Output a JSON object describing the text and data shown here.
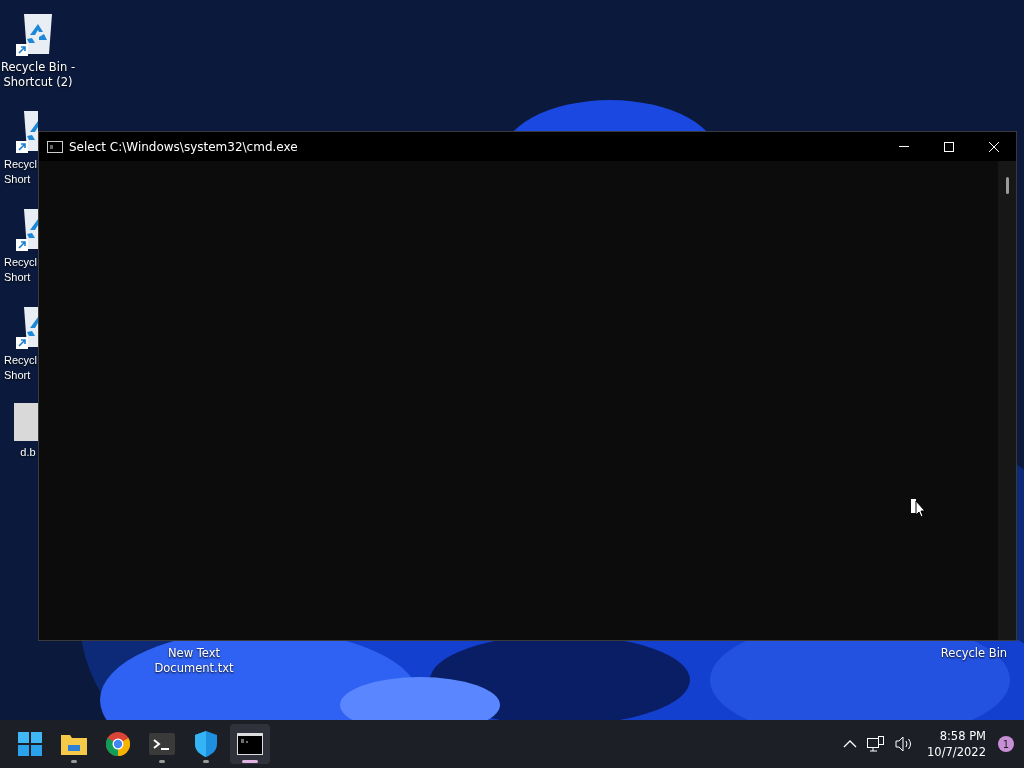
{
  "desktop": {
    "icons": [
      {
        "kind": "recycle",
        "lines": [
          "Recycle Bin -",
          "Shortcut (2)"
        ]
      },
      {
        "kind": "recycle",
        "lines": [
          "Recycl",
          "Short"
        ]
      },
      {
        "kind": "recycle",
        "lines": [
          "Recycl",
          "Short"
        ]
      },
      {
        "kind": "recycle",
        "lines": [
          "Recycl",
          "Short"
        ]
      },
      {
        "kind": "file",
        "lines": [
          "d.b"
        ]
      },
      {
        "kind": "hidden",
        "lines": [
          "New Text",
          "Document.txt"
        ]
      },
      {
        "kind": "hidden",
        "lines": [
          "Recycle Bin"
        ]
      }
    ]
  },
  "window": {
    "title": "Select C:\\Windows\\system32\\cmd.exe",
    "active": true
  },
  "taskbar": {
    "apps": [
      {
        "kind": "start",
        "running": false,
        "selected": false
      },
      {
        "kind": "explorer",
        "running": true,
        "selected": false
      },
      {
        "kind": "chrome",
        "running": false,
        "selected": false
      },
      {
        "kind": "terminal",
        "running": true,
        "selected": false
      },
      {
        "kind": "defender",
        "running": true,
        "selected": false
      },
      {
        "kind": "cmd",
        "running": true,
        "selected": true
      }
    ]
  },
  "tray": {
    "time": "8:58 PM",
    "date": "10/7/2022",
    "notifications": "1"
  }
}
